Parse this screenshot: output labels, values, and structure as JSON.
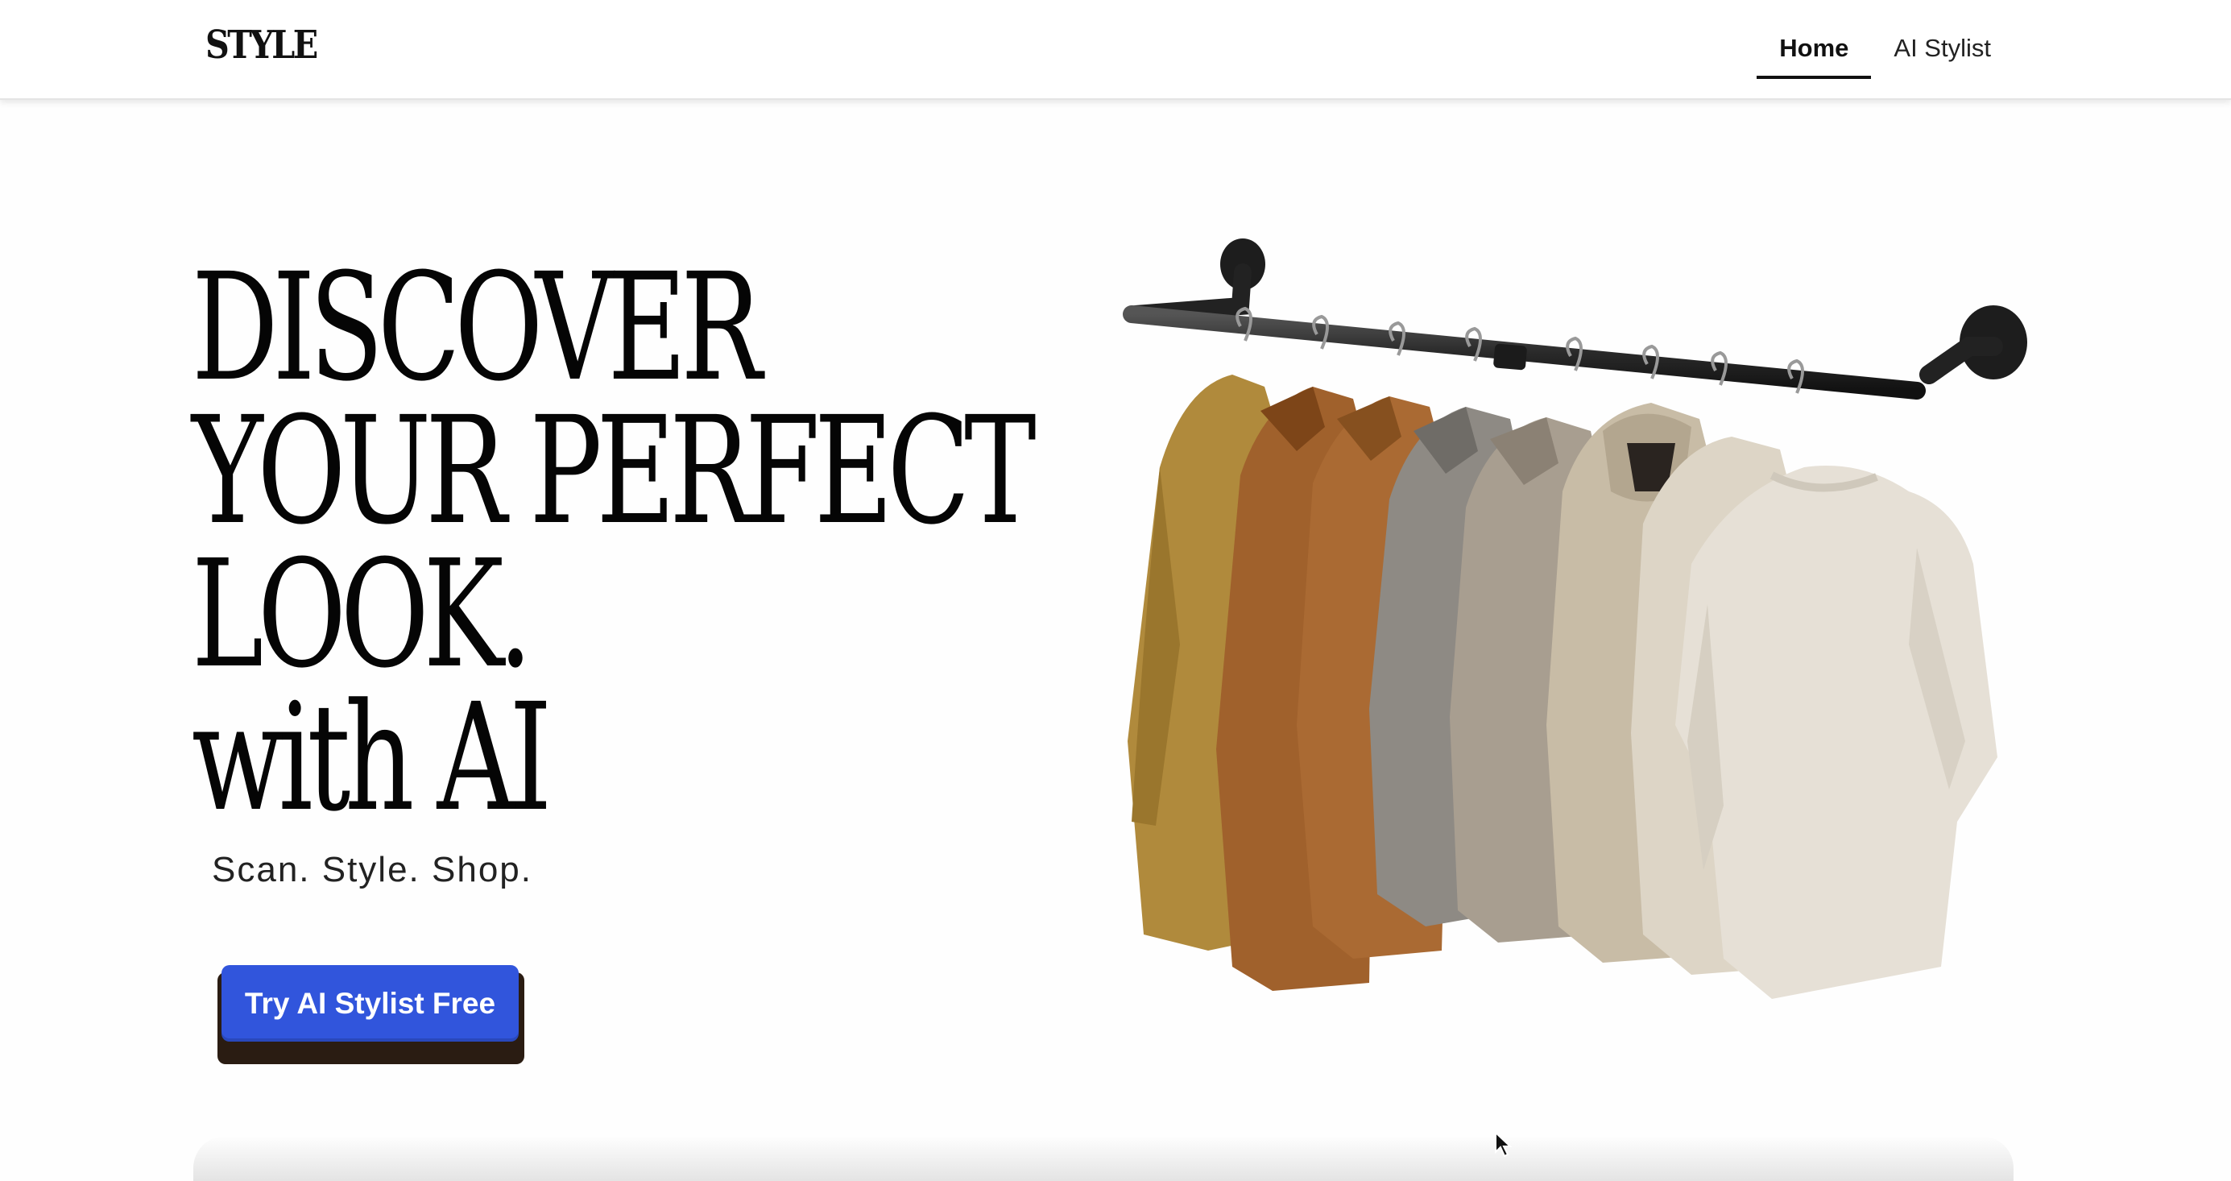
{
  "header": {
    "logo": "STYLE",
    "nav": [
      {
        "label": "Home",
        "active": true
      },
      {
        "label": "AI Stylist",
        "active": false
      }
    ]
  },
  "hero": {
    "headline_lines": [
      "DISCOVER",
      "YOUR PERFECT",
      "LOOK.",
      "with AI"
    ],
    "tagline": "Scan. Style. Shop.",
    "cta_label": "Try AI Stylist Free",
    "image": "clothes-rack-with-neutral-shirts"
  },
  "colors": {
    "cta": "#3155dc",
    "cta_shadow": "#2a1c12",
    "text": "#111111",
    "nav_active_underline": "#111111"
  }
}
